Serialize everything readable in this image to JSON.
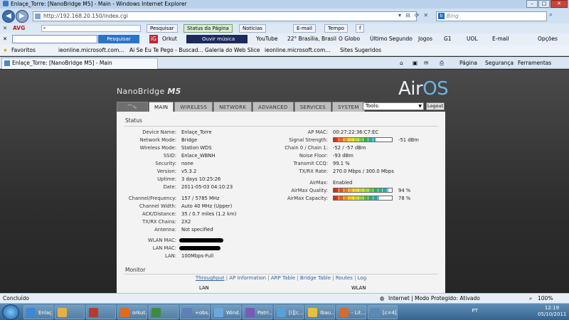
{
  "window": {
    "title": "Enlaçe_Torre: [NanoBridge M5] - Main - Windows Internet Explorer"
  },
  "address": {
    "url": "http://192.168.20.150/index.cgi",
    "search_placeholder": "Bing"
  },
  "menubar": {
    "avg": "AVG",
    "pesquisar": "Pesquisar",
    "status_pagina": "Status da Página",
    "noticias": "Notícias",
    "email": "E-mail",
    "tempo": "Tempo"
  },
  "toolbar2": {
    "search_button": "Pesquisar",
    "orkut": "Orkut",
    "music": "Ouvir música",
    "youtube": "YouTube",
    "weather": "22° Brasília, Brasil",
    "oglobo": "O Globo",
    "ultimo": "Último Segundo",
    "jogos": "Jogos",
    "g1": "G1",
    "uol": "UOL",
    "email": "E-mail",
    "opcoes": "Opções"
  },
  "favorites": {
    "label": "Favoritos",
    "items": [
      "ieonline.microsoft.com...",
      "Ai Se Eu Te Pego - Buscad...",
      "Galeria do Web Slice",
      "ieonline.microsoft.com...",
      "Sites Sugeridos"
    ]
  },
  "tabbar": {
    "tab_title": "Enlaçe_Torre: [NanoBridge M5] - Main",
    "pagina": "Página",
    "seguranca": "Segurança",
    "ferramentas": "Ferramentas"
  },
  "airos": {
    "product": "NanoBridge",
    "product_model": "M5",
    "logo_main": "Air",
    "logo_os": "OS",
    "nav": [
      "MAIN",
      "WIRELESS",
      "NETWORK",
      "ADVANCED",
      "SERVICES",
      "SYSTEM"
    ],
    "tools_select": "Tools:",
    "logout": "Logout"
  },
  "status": {
    "title": "Status",
    "left": [
      {
        "label": "Device Name:",
        "value": "Enlaçe_Torre"
      },
      {
        "label": "Network Mode:",
        "value": "Bridge"
      },
      {
        "label": "Wireless Mode:",
        "value": "Station WDS"
      },
      {
        "label": "SSID:",
        "value": "Enlace_WBNH"
      },
      {
        "label": "Security:",
        "value": "none"
      },
      {
        "label": "Version:",
        "value": "v5.3.2"
      },
      {
        "label": "Uptime:",
        "value": "3 days 10:25:26"
      },
      {
        "label": "Date:",
        "value": "2011-05-03 04:10:23"
      },
      {
        "label": "Channel/Frequency:",
        "value": "157 / 5785 MHz"
      },
      {
        "label": "Channel Width:",
        "value": "Auto 40 MHz  (Upper)"
      },
      {
        "label": "ACK/Distance:",
        "value": "35 / 0.7 miles (1.2 km)"
      },
      {
        "label": "TX/RX Chains:",
        "value": "2X2"
      },
      {
        "label": "Antenna:",
        "value": "Not specified"
      }
    ],
    "wlan_mac_label": "WLAN MAC:",
    "lan_mac_label": "LAN MAC:",
    "lan_label": "LAN:",
    "lan_value": "100Mbps-Full",
    "right": {
      "ap_mac_label": "AP MAC:",
      "ap_mac": "00:27:22:36:C7:EC",
      "signal_label": "Signal Strength:",
      "signal_value": "-51 dBm",
      "signal_level": 0.72,
      "chain_label": "Chain 0 / Chain 1:",
      "chain_value": "-52  /  -57  dBm",
      "noise_label": "Noise Floor:",
      "noise_value": "-93 dBm",
      "ccq_label": "Transmit CCQ:",
      "ccq_value": "99.1 %",
      "rate_label": "TX/RX Rate:",
      "rate_value": "270.0 Mbps  /  300.0 Mbps",
      "airmax_label": "AirMax:",
      "airmax_value": "Enabled",
      "quality_label": "AirMax Quality:",
      "quality_value": "94  %",
      "quality_level": 0.94,
      "capacity_label": "AirMax Capacity:",
      "capacity_value": "78  %",
      "capacity_level": 0.78
    }
  },
  "monitor": {
    "title": "Monitor",
    "links": [
      "Throughput",
      "AP Information",
      "ARP Table",
      "Bridge Table",
      "Routes",
      "Log"
    ],
    "col_lan": "LAN",
    "col_wlan": "WLAN"
  },
  "statusbar": {
    "left": "Concluído",
    "zone": "Internet | Modo Protegido: Ativado",
    "zoom": "100%"
  },
  "taskbar": {
    "items": [
      "Enlaç...",
      "",
      "",
      "orkut...",
      "",
      "+obs...",
      "Wind...",
      "Patri...",
      "[i][c...",
      "Ibau...",
      "- Lit...",
      "[c=4]..."
    ],
    "lang": "PT",
    "time": "12:19",
    "date": "05/10/2011"
  }
}
